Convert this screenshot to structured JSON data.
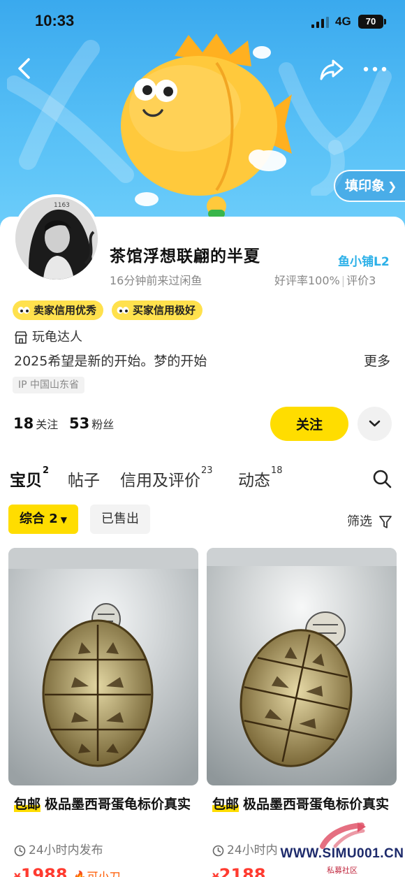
{
  "status_bar": {
    "time": "10:33",
    "network": "4G",
    "battery": "70"
  },
  "banner": {
    "impression_button": "填印象",
    "colors": {
      "sky": "#4bb6f3",
      "mascot": "#ffc93c"
    }
  },
  "profile": {
    "shop_name": "茶馆浮想联翩的半夏",
    "shop_level": "鱼小铺L2",
    "last_seen": "16分钟前来过闲鱼",
    "good_rate": "好评率100%",
    "review_count": "评价3",
    "badges": [
      {
        "label": "卖家信用优秀"
      },
      {
        "label": "买家信用极好"
      }
    ],
    "tag": "玩龟达人",
    "bio": "2025希望是新的开始。梦的开始",
    "bio_more": "更多",
    "ip_location": "IP 中国山东省",
    "following_count": "18",
    "following_label": "关注",
    "fans_count": "53",
    "fans_label": "粉丝",
    "follow_button": "关注"
  },
  "tabs": [
    {
      "label": "宝贝",
      "count": "2"
    },
    {
      "label": "帖子",
      "count": ""
    },
    {
      "label": "信用及评价",
      "count": "23"
    },
    {
      "label": "动态",
      "count": "18"
    }
  ],
  "filters": {
    "all": "综合 2",
    "sold": "已售出",
    "filter_label": "筛选"
  },
  "products": [
    {
      "free_shipping": "包邮",
      "title": "极品墨西哥蛋龟标价真实",
      "time": "24小时内发布",
      "currency": "¥",
      "price": "1988",
      "bargain": "可小刀"
    },
    {
      "free_shipping": "包邮",
      "title": "极品墨西哥蛋龟标价真实",
      "time": "24小时内",
      "currency": "¥",
      "price": "2188",
      "bargain": ""
    }
  ],
  "watermark": {
    "site": "WWW.SIMU001.CN",
    "label": "私募社区"
  },
  "accent_color": "#ffdd00",
  "price_color": "#ff3b30"
}
